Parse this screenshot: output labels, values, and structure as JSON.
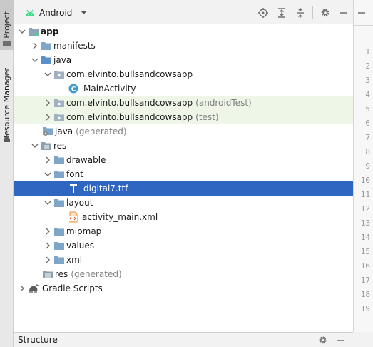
{
  "side_tabs": {
    "project": "Project",
    "resource_manager": "Resource Manager"
  },
  "toolbar": {
    "view_label": "Android"
  },
  "colors": {
    "selection": "#2e66c1",
    "tinted_row": "#eef6e8",
    "folder": "#7da6c9",
    "android_green": "#3ddc84"
  },
  "tree": {
    "app": "app",
    "manifests": "manifests",
    "java": "java",
    "pkg_main": "com.elvinto.bullsandcowsapp",
    "main_activity": "MainActivity",
    "class_badge": "C",
    "pkg_android_test": "com.elvinto.bullsandcowsapp",
    "pkg_android_test_suffix": "(androidTest)",
    "pkg_test": "com.elvinto.bullsandcowsapp",
    "pkg_test_suffix": "(test)",
    "java_generated": "java",
    "java_generated_suffix": "(generated)",
    "res": "res",
    "drawable": "drawable",
    "font": "font",
    "digital7": "digital7.ttf",
    "layout": "layout",
    "activity_main": "activity_main.xml",
    "mipmap": "mipmap",
    "values": "values",
    "xml": "xml",
    "res_generated": "res",
    "res_generated_suffix": "(generated)",
    "gradle_scripts": "Gradle Scripts"
  },
  "line_numbers": [
    "1",
    "2",
    "3",
    "4",
    "5",
    "6",
    "7",
    "8",
    "9",
    "10",
    "11",
    "12",
    "13",
    "14",
    "15",
    "16",
    "17",
    "18",
    "19"
  ],
  "structure": {
    "title": "Structure"
  }
}
